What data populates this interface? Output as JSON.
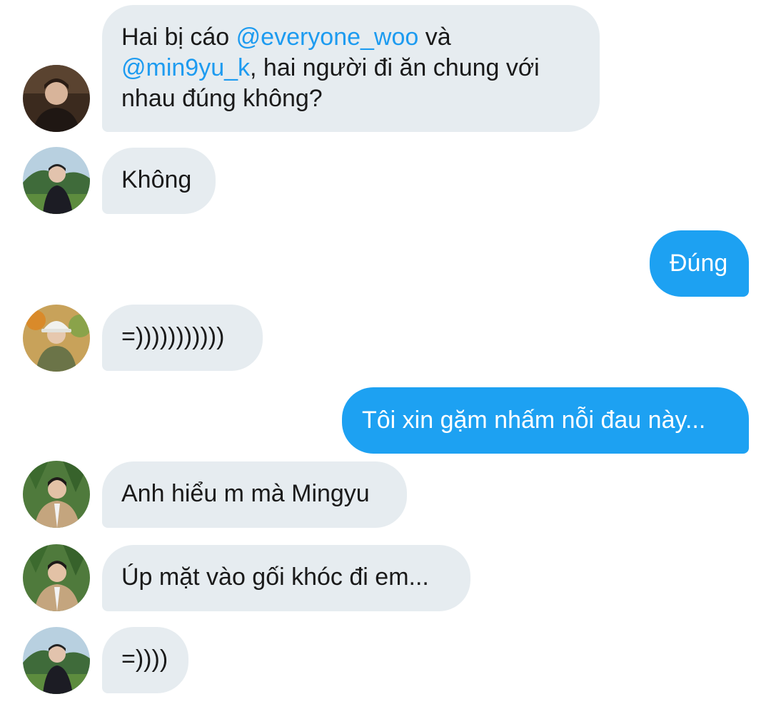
{
  "messages": [
    {
      "direction": "incoming",
      "avatar": "avatar-dark-jacket",
      "parts": {
        "text1": "Hai bị cáo ",
        "mention1": "@everyone_woo",
        "text2": " và",
        "mention2": "@min9yu_k",
        "text3": ", hai người đi ăn chung với",
        "text4": "nhau đúng không?"
      }
    },
    {
      "direction": "incoming",
      "avatar": "avatar-mountain-field",
      "text": "Không"
    },
    {
      "direction": "outgoing",
      "text": "Đúng"
    },
    {
      "direction": "incoming",
      "avatar": "avatar-bucket-hat",
      "text": "=)))))))))))"
    },
    {
      "direction": "outgoing",
      "text": "Tôi xin gặm nhấm nỗi đau này..."
    },
    {
      "direction": "incoming",
      "avatar": "avatar-forest-coat",
      "text": "Anh hiểu m mà Mingyu"
    },
    {
      "direction": "incoming",
      "avatar": "avatar-forest-coat",
      "text": "Úp mặt vào gối khóc đi em..."
    },
    {
      "direction": "incoming",
      "avatar": "avatar-mountain-field",
      "text": "=))))"
    }
  ],
  "colors": {
    "incoming_bubble": "#e6ecf0",
    "outgoing_bubble": "#1da1f2",
    "mention": "#1d9bf0",
    "incoming_text": "#1a1a1a",
    "outgoing_text": "#ffffff"
  }
}
